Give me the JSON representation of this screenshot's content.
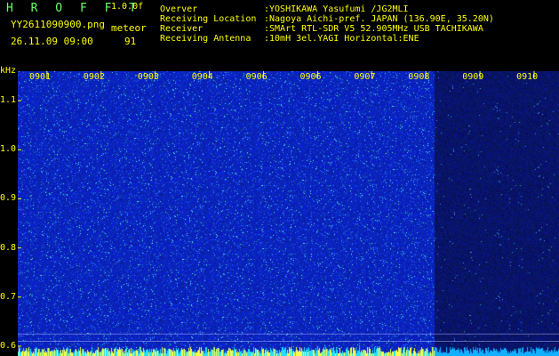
{
  "header": {
    "title": "H R O F F T",
    "version": "1.0.0f",
    "filename": "YY2611090900.png",
    "meteor_label": "meteor",
    "timestamp": "26.11.09 09:00",
    "meteor_count": "91",
    "info": [
      {
        "key": "Overver",
        "value": ":YOSHIKAWA Yasufumi /JG2MLI"
      },
      {
        "key": "Receiving Location",
        "value": ":Nagoya Aichi-pref. JAPAN (136.90E, 35.20N)"
      },
      {
        "key": "Receiver",
        "value": ":SMArt RTL-SDR V5 52.905MHz USB TACHIKAWA"
      },
      {
        "key": "Receiving Antenna",
        "value": ":10mH 3el.YAGI Horizontal:ENE"
      }
    ]
  },
  "chart_data": {
    "type": "heatmap",
    "y_unit": "kHz",
    "y_ticks": [
      "1.1",
      "1.0",
      "0.9",
      "0.8",
      "0.7",
      "0.6"
    ],
    "y_values": [
      1.1,
      1.0,
      0.9,
      0.8,
      0.7,
      0.6
    ],
    "ylim": [
      0.58,
      1.16
    ],
    "x_ticks": [
      "0901",
      "0902",
      "0903",
      "0904",
      "0905",
      "0906",
      "0907",
      "0908",
      "0909",
      "0910"
    ],
    "x_tick_labels": [
      "0901",
      "0902",
      "0903",
      "0904",
      "0906",
      "0906",
      "0907",
      "0908",
      "0909",
      "0910"
    ],
    "bright_region_end_fraction": 0.77,
    "colors": {
      "bright_bg": "#1526c8",
      "dim_bg": "#0d1580",
      "tick": "#ffff00",
      "baseline": "#00c8ff"
    }
  }
}
